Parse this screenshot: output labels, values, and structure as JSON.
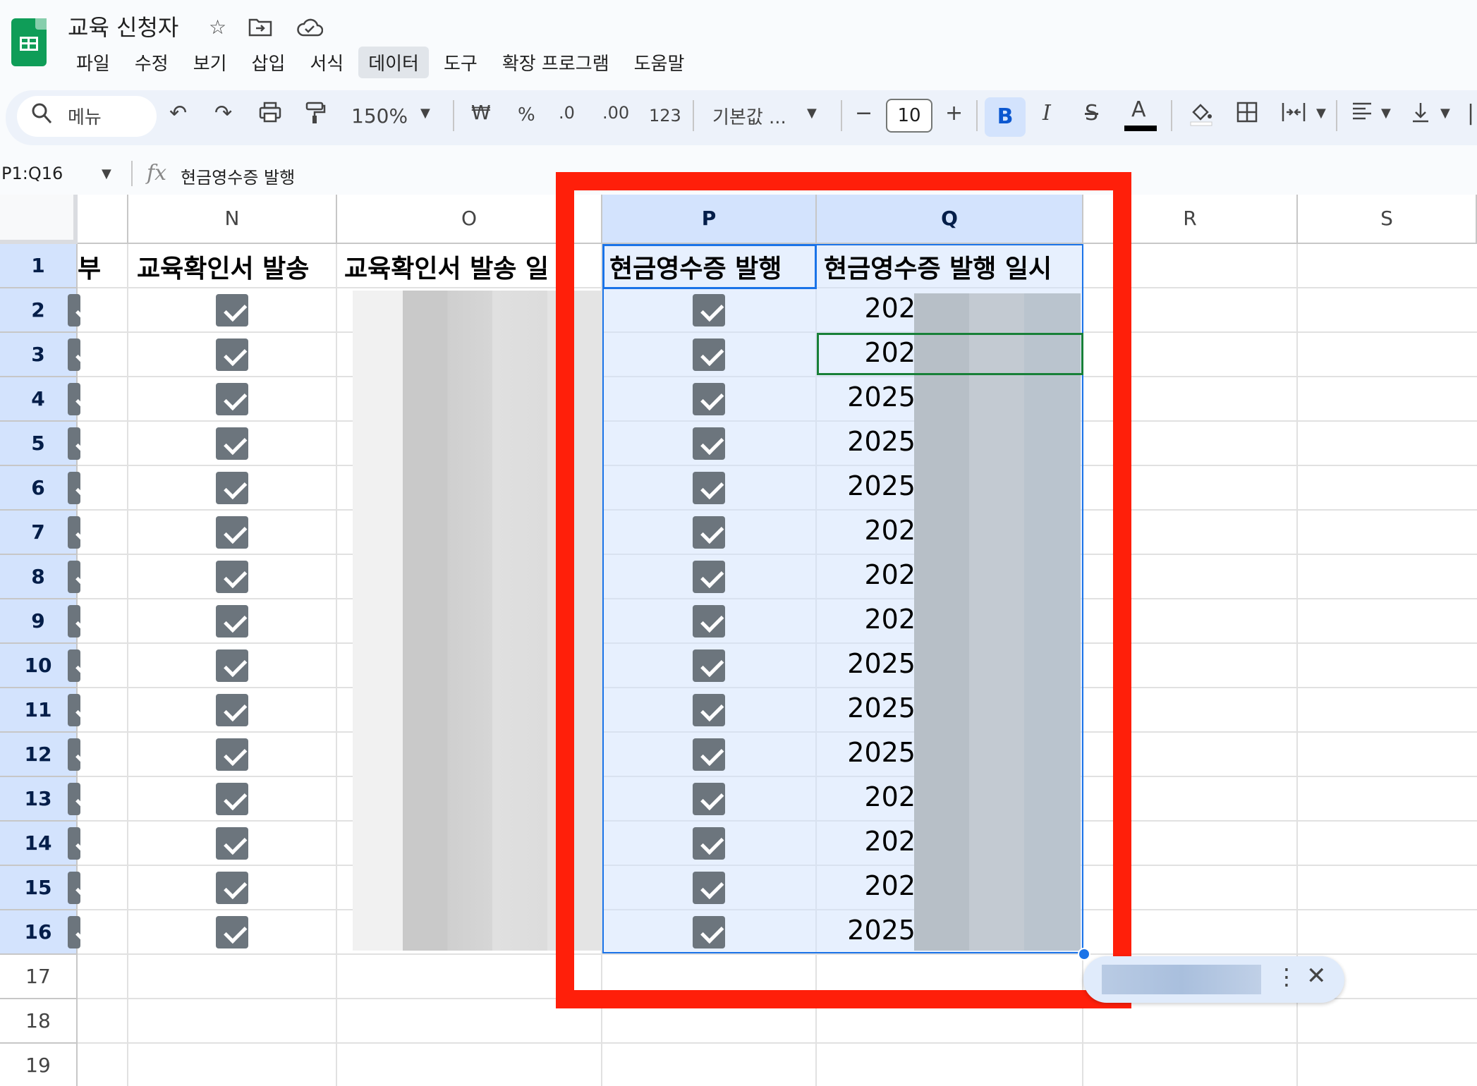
{
  "app": {
    "doc_title": "교육 신청자",
    "title_icons": [
      "star-icon",
      "move-to-folder-icon",
      "cloud-saved-icon"
    ],
    "accent": "#0f9d58"
  },
  "menu": [
    "파일",
    "수정",
    "보기",
    "삽입",
    "서식",
    "데이터",
    "도구",
    "확장 프로그램",
    "도움말"
  ],
  "toolbar": {
    "search_label": "메뉴",
    "zoom": "150%",
    "currency": "₩",
    "percent": "%",
    "decrease_decimal": ".0",
    "increase_decimal": ".00",
    "number_format": "123",
    "font": "기본값 ...",
    "font_size": "10",
    "bold": "B",
    "italic": "I",
    "text_color_letter": "A"
  },
  "formula_bar": {
    "name_box": "P1:Q16",
    "fx": "fx",
    "formula": "현금영수증 발행"
  },
  "sheet": {
    "columns": [
      "N",
      "O",
      "P",
      "Q",
      "R",
      "S"
    ],
    "selected_columns": [
      "P",
      "Q"
    ],
    "rows": [
      "1",
      "2",
      "3",
      "4",
      "5",
      "6",
      "7",
      "8",
      "9",
      "10",
      "11",
      "12",
      "13",
      "14",
      "15",
      "16",
      "17",
      "18",
      "19"
    ],
    "headers": {
      "M_partial": "부",
      "N": "교육확인서 발송",
      "O": "교육확인서 발송 일",
      "P": "현금영수증 발행",
      "Q": "현금영수증 발행 일시"
    },
    "q_values": [
      "202",
      "202",
      "2025",
      "2025",
      "2025",
      "202",
      "202",
      "202",
      "2025",
      "2025",
      "2025",
      "202",
      "202",
      "202",
      "2025"
    ],
    "checked_rows": 15,
    "selection_color": "#1a73e8",
    "highlight_box_color": "#ff1f0a"
  }
}
